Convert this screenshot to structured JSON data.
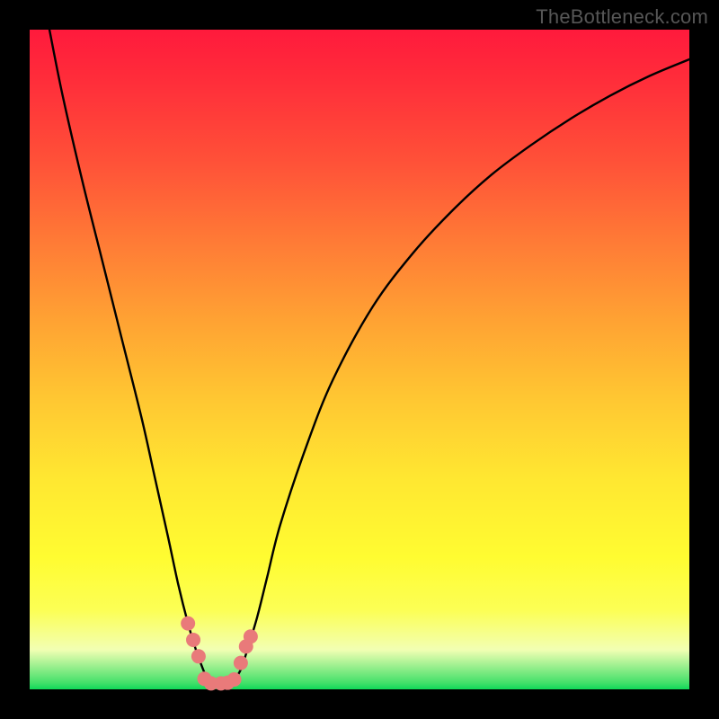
{
  "watermark": "TheBottleneck.com",
  "colors": {
    "frame": "#000000",
    "curve": "#000000",
    "marker": "#e97a7a"
  },
  "chart_data": {
    "type": "line",
    "title": "",
    "xlabel": "",
    "ylabel": "",
    "xlim": [
      0,
      100
    ],
    "ylim": [
      0,
      100
    ],
    "series": [
      {
        "name": "curve",
        "x": [
          3,
          5,
          8,
          11,
          14,
          17,
          19,
          21,
          22.5,
          24,
          25.2,
          26.3,
          27,
          27.8,
          28.5,
          30,
          31,
          32,
          33,
          34.5,
          36,
          38,
          42,
          46,
          52,
          58,
          64,
          70,
          76,
          82,
          88,
          94,
          100
        ],
        "y": [
          100,
          90,
          77,
          65,
          53,
          41,
          32,
          23,
          16,
          10,
          6,
          3,
          1.4,
          0.9,
          0.9,
          0.9,
          1.5,
          3,
          6,
          11,
          17,
          25,
          37,
          47,
          58,
          66,
          72.5,
          78,
          82.5,
          86.5,
          90,
          93,
          95.5
        ]
      }
    ],
    "markers": [
      {
        "x": 24.0,
        "y": 10.0
      },
      {
        "x": 24.8,
        "y": 7.5
      },
      {
        "x": 25.6,
        "y": 5.0
      },
      {
        "x": 26.5,
        "y": 1.6
      },
      {
        "x": 27.5,
        "y": 0.9
      },
      {
        "x": 29.0,
        "y": 0.9
      },
      {
        "x": 30.0,
        "y": 1.0
      },
      {
        "x": 31.0,
        "y": 1.5
      },
      {
        "x": 32.0,
        "y": 4.0
      },
      {
        "x": 32.8,
        "y": 6.5
      },
      {
        "x": 33.5,
        "y": 8.0
      }
    ]
  }
}
